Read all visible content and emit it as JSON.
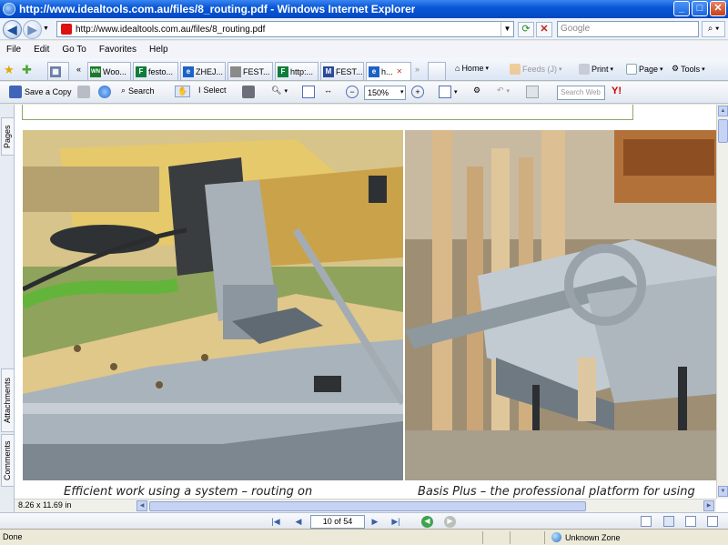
{
  "window": {
    "title": "http://www.idealtools.com.au/files/8_routing.pdf - Windows Internet Explorer",
    "controls": {
      "minimize": "_",
      "maximize": "□",
      "close": "✕"
    }
  },
  "address_bar": {
    "url": "http://www.idealtools.com.au/files/8_routing.pdf",
    "search_placeholder": "Google"
  },
  "menu": [
    "File",
    "Edit",
    "Go To",
    "Favorites",
    "Help"
  ],
  "tabs": [
    {
      "label": "",
      "favicon": "grid",
      "color": "#6d7fa8"
    },
    {
      "label": "Woo...",
      "favicon": "WN",
      "color": "#1a7a2a"
    },
    {
      "label": "festo...",
      "favicon": "F",
      "color": "#0d7d3a"
    },
    {
      "label": "ZHEJ...",
      "favicon": "e",
      "color": "#1d62c7"
    },
    {
      "label": "FEST...",
      "favicon": "page",
      "color": "#7a7a7a"
    },
    {
      "label": "http:...",
      "favicon": "F",
      "color": "#0d7d3a"
    },
    {
      "label": "FEST...",
      "favicon": "M",
      "color": "#2a4a9a"
    },
    {
      "label": "h...",
      "favicon": "e",
      "color": "#1d62c7"
    }
  ],
  "command_bar": {
    "home": "Home",
    "feeds": "Feeds (J)",
    "print": "Print",
    "page": "Page",
    "tools": "Tools"
  },
  "acrobat_toolbar": {
    "save_copy": "Save a Copy",
    "search": "Search",
    "select": "Select",
    "zoom": "150%",
    "search_web_placeholder": "Search Web",
    "yahoo": "Y!"
  },
  "side_panel": {
    "pages": "Pages",
    "attachments": "Attachments",
    "comments": "Comments"
  },
  "document": {
    "caption_left": "Efficient work using a system – routing on",
    "caption_right": "Basis Plus – the professional platform for using",
    "page_size": "8.26 x 11.69 in"
  },
  "page_navigation": {
    "current": "10 of 54"
  },
  "status_bar": {
    "status": "Done",
    "zone": "Unknown Zone"
  }
}
